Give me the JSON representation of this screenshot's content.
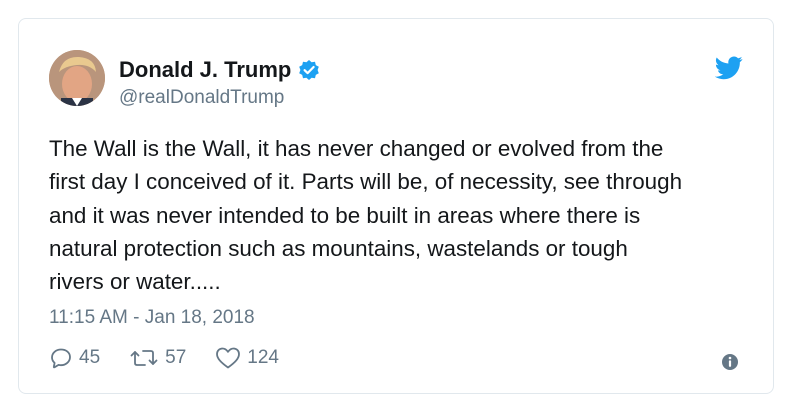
{
  "tweet": {
    "author_name": "Donald J. Trump",
    "handle": "@realDonaldTrump",
    "text_lines": [
      "The Wall is the Wall, it has never changed or evolved from the",
      "first day I conceived of it. Parts will be, of necessity, see through",
      "and it was never intended to be built in areas where there is",
      "natural protection such as mountains, wastelands or tough",
      "rivers or water....."
    ],
    "timestamp": "11:15 AM - Jan 18, 2018",
    "replies": "45",
    "retweets": "57",
    "likes": "124"
  },
  "icons": {
    "verified": "verified-badge-icon",
    "brand": "twitter-bird-icon",
    "reply": "reply-icon",
    "retweet": "retweet-icon",
    "like": "heart-icon",
    "info": "info-icon"
  },
  "colors": {
    "brand_blue": "#1da1f2",
    "text": "#14171a",
    "muted": "#657786",
    "border": "#e1e8ed"
  }
}
